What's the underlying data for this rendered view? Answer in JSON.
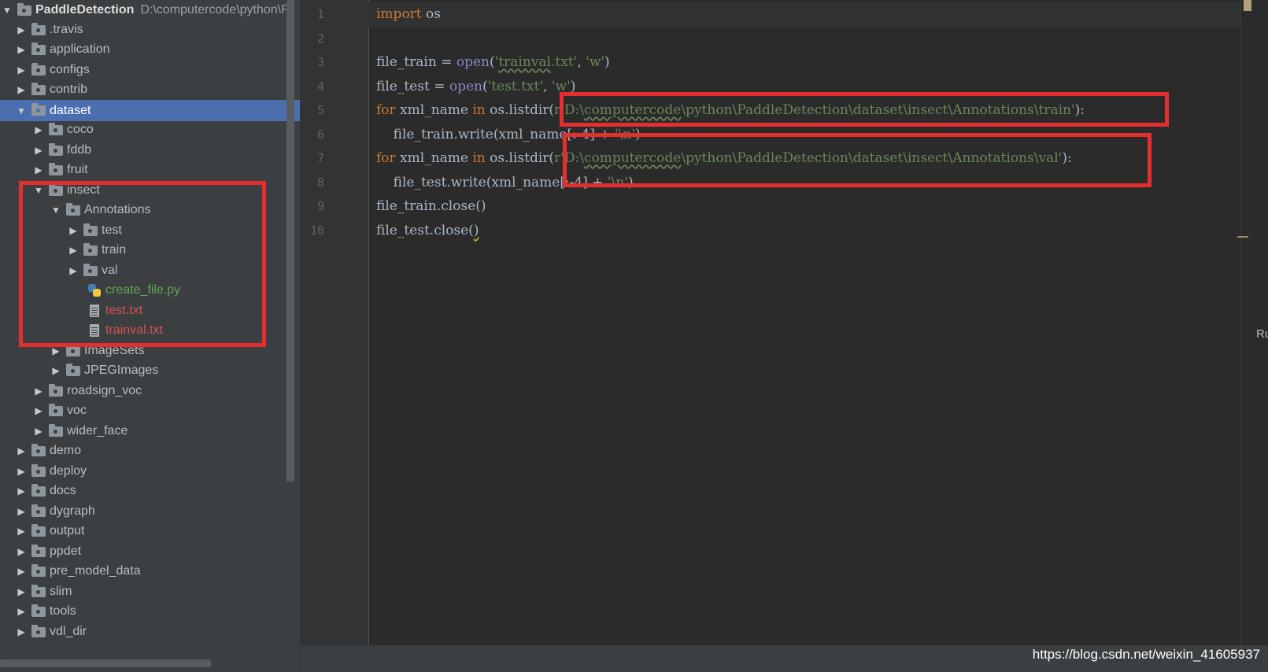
{
  "project": {
    "name": "PaddleDetection",
    "path": "D:\\computercode\\python\\P"
  },
  "tree": [
    {
      "label": ".travis"
    },
    {
      "label": "application"
    },
    {
      "label": "configs"
    },
    {
      "label": "contrib"
    },
    {
      "label": "dataset"
    },
    {
      "label": "coco"
    },
    {
      "label": "fddb"
    },
    {
      "label": "fruit"
    },
    {
      "label": "insect"
    },
    {
      "label": "Annotations"
    },
    {
      "label": "test"
    },
    {
      "label": "train"
    },
    {
      "label": "val"
    },
    {
      "label": "create_file.py"
    },
    {
      "label": "test.txt"
    },
    {
      "label": "trainval.txt"
    },
    {
      "label": "ImageSets"
    },
    {
      "label": "JPEGImages"
    },
    {
      "label": "roadsign_voc"
    },
    {
      "label": "voc"
    },
    {
      "label": "wider_face"
    },
    {
      "label": "demo"
    },
    {
      "label": "deploy"
    },
    {
      "label": "docs"
    },
    {
      "label": "dygraph"
    },
    {
      "label": "output"
    },
    {
      "label": "ppdet"
    },
    {
      "label": "pre_model_data"
    },
    {
      "label": "slim"
    },
    {
      "label": "tools"
    },
    {
      "label": "vdl_dir"
    }
  ],
  "code": {
    "line_numbers": [
      "1",
      "2",
      "3",
      "4",
      "5",
      "6",
      "7",
      "8",
      "9",
      "10"
    ],
    "l1": {
      "kw": "import",
      "rest": " os"
    },
    "l3": {
      "a": "file_train = ",
      "fn": "open",
      "b": "(",
      "s1": "'",
      "s1w": "trainval",
      "s1b": ".txt'",
      "c": ", ",
      "s2": "'w'",
      "d": ")"
    },
    "l4": {
      "a": "file_test = ",
      "fn": "open",
      "b": "(",
      "s1": "'test.txt'",
      "c": ", ",
      "s2": "'w'",
      "d": ")"
    },
    "l5": {
      "kw": "for",
      "a": " xml_name ",
      "kw2": "in",
      "b": " os.listdir(",
      "s1": "r'D:\\",
      "s1w": "computercode",
      "s1b": "\\python\\PaddleDetection\\dataset\\insect\\Annotations\\train'",
      "c": "):"
    },
    "l6": {
      "a": "    file_train.write(xml_name[:-4] + ",
      "s": "'\\n'",
      "b": ")"
    },
    "l7": {
      "kw": "for",
      "a": " xml_name ",
      "kw2": "in",
      "b": " os.listdir(",
      "s1": "r'D:\\",
      "s1w": "computercode",
      "s1b": "\\python\\PaddleDetection\\dataset\\insect\\Annotations\\val'",
      "c": "):"
    },
    "l8": {
      "a": "    file_test.write(xml_name[:-4] + ",
      "s": "'\\n'",
      "b": ")"
    },
    "l9": {
      "a": "file_train.close()"
    },
    "l10": {
      "a": "file_test.close(",
      "b": ")"
    }
  },
  "edge_text": "Ru",
  "watermark": "https://blog.csdn.net/weixin_41605937",
  "colors": {
    "highlight_box": "#e62e2e",
    "selection": "#4b6eaf",
    "keyword": "#cc7832",
    "string": "#6a8759",
    "builtin": "#8888c6"
  }
}
